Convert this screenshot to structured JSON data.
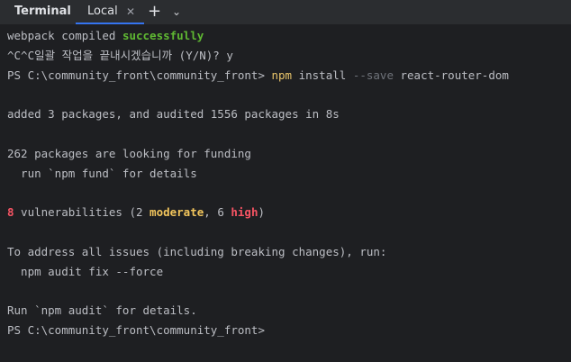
{
  "tabbar": {
    "title": "Terminal",
    "tab_label": "Local",
    "tab_close": "✕",
    "add": "+",
    "dropdown": "⌄"
  },
  "terminal": {
    "l1": {
      "a": "webpack compiled ",
      "b": "successfully"
    },
    "l2": "^C^C일괄 작업을 끝내시겠습니까 (Y/N)? y",
    "l3": {
      "prompt": "PS C:\\community_front\\community_front> ",
      "cmd": "npm",
      "arg1": " install ",
      "flag": "--save",
      "arg2": " react-router-dom"
    },
    "l4": "",
    "l5": "added 3 packages, and audited 1556 packages in 8s",
    "l6": "",
    "l7": "262 packages are looking for funding",
    "l8": "  run `npm fund` for details",
    "l9": "",
    "l10": {
      "count": "8",
      "a": " vulnerabilities (2 ",
      "moderate": "moderate",
      "b": ", 6 ",
      "high": "high",
      "c": ")"
    },
    "l11": "",
    "l12": "To address all issues (including breaking changes), run:",
    "l13": "  npm audit fix --force",
    "l14": "",
    "l15": "Run `npm audit` for details.",
    "l16": "PS C:\\community_front\\community_front>"
  }
}
